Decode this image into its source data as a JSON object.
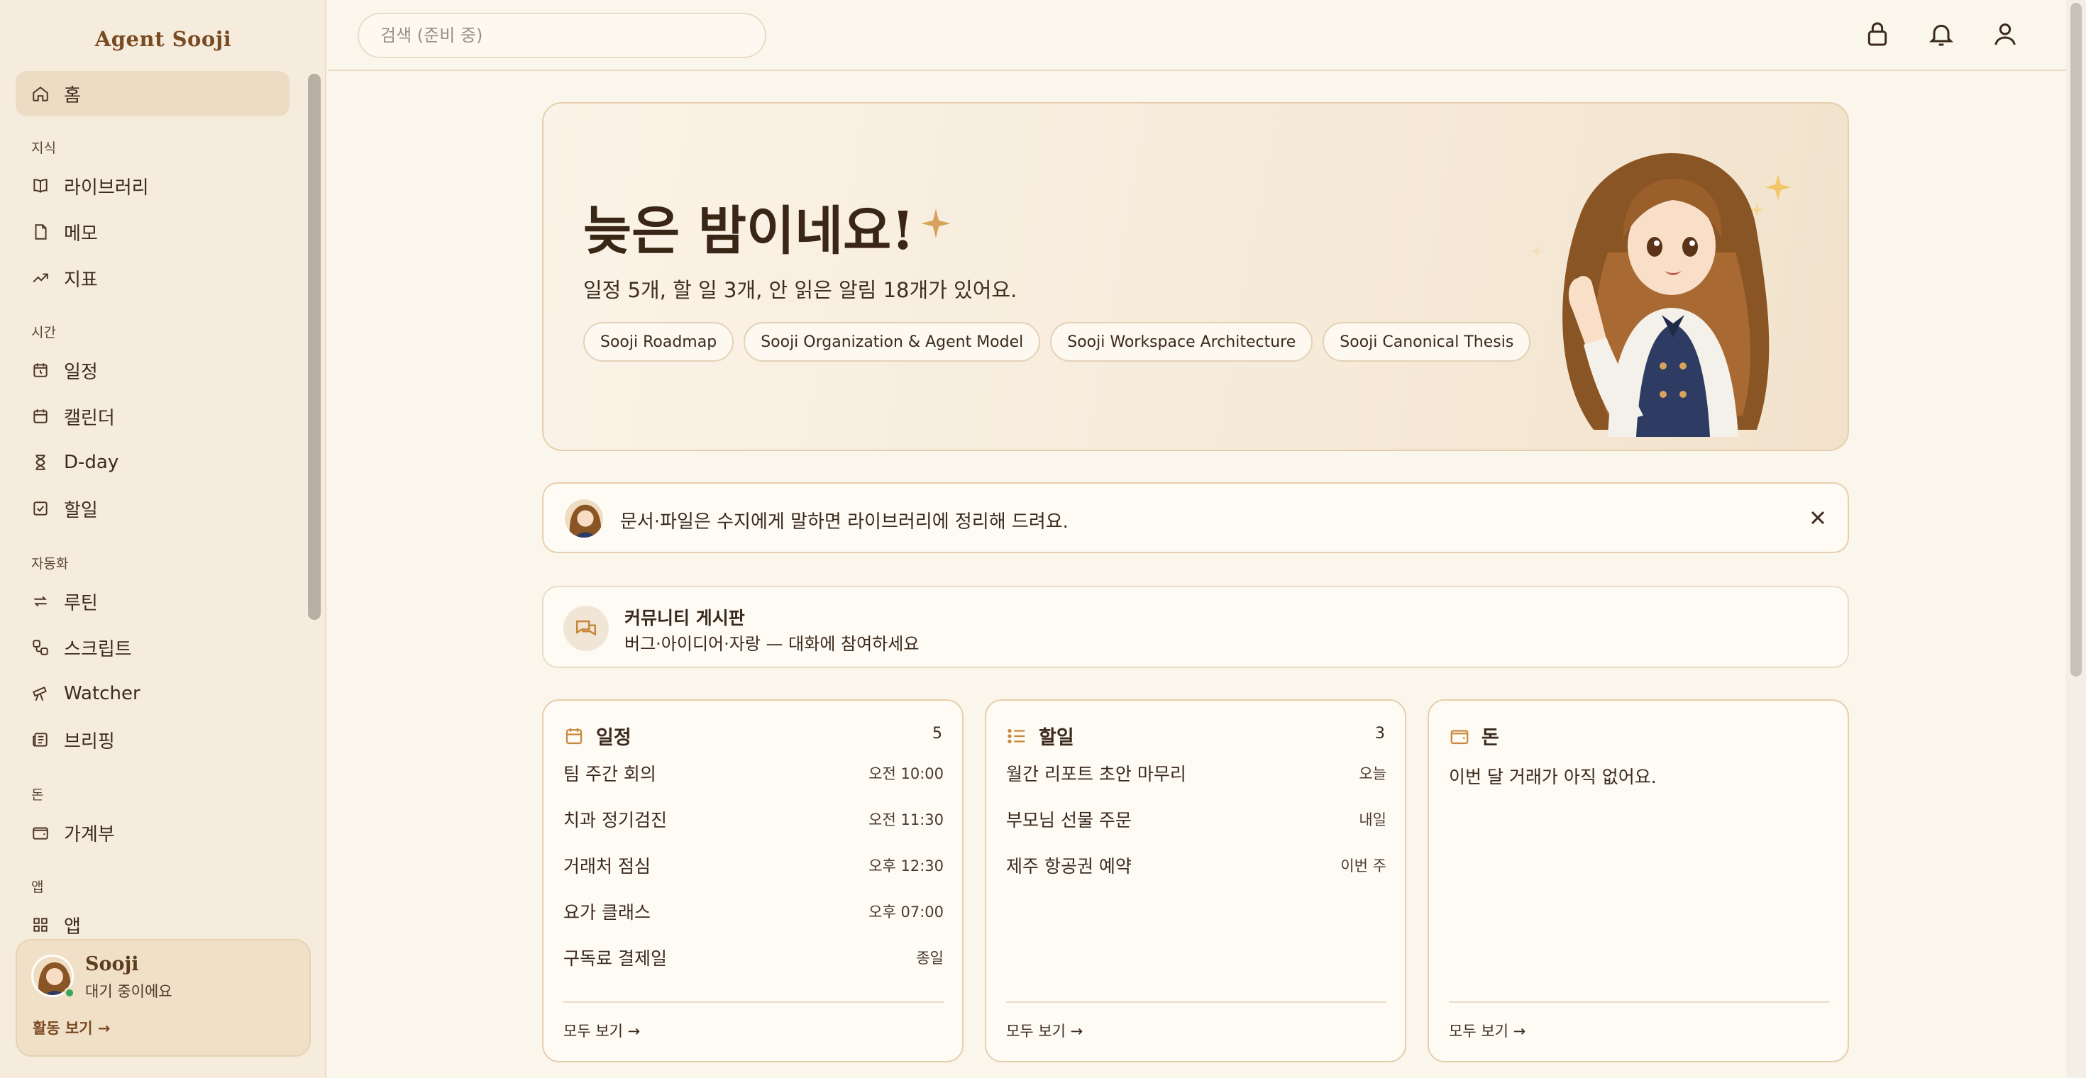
{
  "app": {
    "brand": "Agent Sooji"
  },
  "sidebar": {
    "home": "홈",
    "sections": {
      "knowledge": "지식",
      "time": "시간",
      "automation": "자동화",
      "money": "돈",
      "apps": "앱"
    },
    "items": {
      "library": "라이브러리",
      "memo": "메모",
      "metrics": "지표",
      "schedule": "일정",
      "calendar": "캘린더",
      "dday": "D-day",
      "todo": "할일",
      "routine": "루틴",
      "script": "스크립트",
      "watcher": "Watcher",
      "briefing": "브리핑",
      "ledger": "가계부",
      "apps": "앱"
    },
    "user": {
      "name": "Sooji",
      "status": "대기 중이에요",
      "activity": "활동 보기 →"
    }
  },
  "header": {
    "search_placeholder": "검색 (준비 중)"
  },
  "hero": {
    "title": "늦은 밤이네요!",
    "subtitle": "일정 5개, 할 일 3개, 안 읽은 알림 18개가 있어요.",
    "chips": [
      "Sooji Roadmap",
      "Sooji Organization & Agent Model",
      "Sooji Workspace Architecture",
      "Sooji Canonical Thesis"
    ]
  },
  "tip": {
    "text": "문서·파일은 수지에게 말하면 라이브러리에 정리해 드려요."
  },
  "community": {
    "title": "커뮤니티 게시판",
    "subtitle": "버그·아이디어·자랑 — 대화에 참여하세요"
  },
  "cards": {
    "schedule": {
      "title": "일정",
      "count": "5",
      "rows": [
        {
          "title": "팀 주간 회의",
          "meta": "오전 10:00"
        },
        {
          "title": "치과 정기검진",
          "meta": "오전 11:30"
        },
        {
          "title": "거래처 점심",
          "meta": "오후 12:30"
        },
        {
          "title": "요가 클래스",
          "meta": "오후 07:00"
        },
        {
          "title": "구독료 결제일",
          "meta": "종일"
        }
      ],
      "more": "모두 보기 →"
    },
    "todo": {
      "title": "할일",
      "count": "3",
      "rows": [
        {
          "title": "월간 리포트 초안 마무리",
          "meta": "오늘"
        },
        {
          "title": "부모님 선물 주문",
          "meta": "내일"
        },
        {
          "title": "제주 항공권 예약",
          "meta": "이번 주"
        }
      ],
      "more": "모두 보기 →"
    },
    "money": {
      "title": "돈",
      "empty": "이번 달 거래가 아직 없어요.",
      "more": "모두 보기 →"
    }
  },
  "colors": {
    "accent": "#c8883a",
    "background": "#fbf6ec",
    "sidebar": "#f6ecdd",
    "online": "#39a45a"
  },
  "icons": [
    "home-icon",
    "book-icon",
    "memo-icon",
    "trend-icon",
    "alarm-icon",
    "calendar-icon",
    "hourglass-icon",
    "check-icon",
    "repeat-icon",
    "script-icon",
    "telescope-icon",
    "news-icon",
    "wallet-icon",
    "grid-icon",
    "lock-icon",
    "bell-icon",
    "user-icon",
    "sparkle-icon",
    "close-icon",
    "chat-icon",
    "list-icon"
  ]
}
